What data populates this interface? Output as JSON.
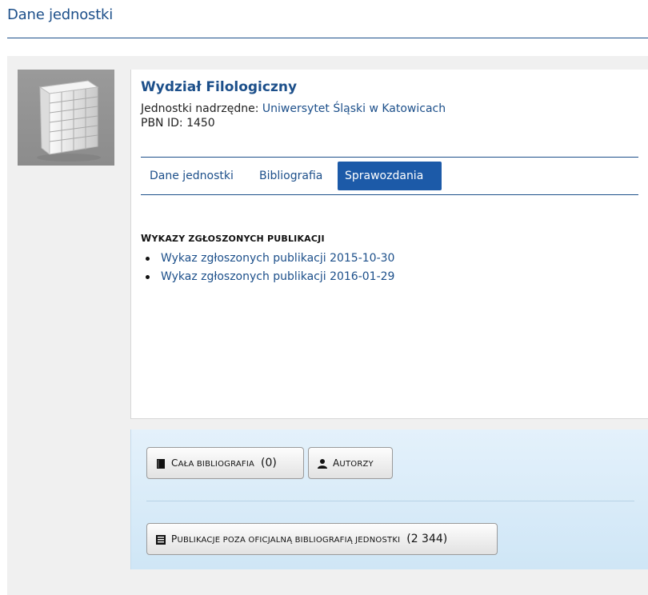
{
  "page": {
    "title": "Dane jednostki"
  },
  "unit": {
    "name": "Wydział Filologiczny",
    "parent_label": "Jednostki nadrzędne:",
    "parent_link": "Uniwersytet Śląski w Katowicach",
    "pbn_label": "PBN ID:",
    "pbn_id": "1450"
  },
  "tabs": [
    {
      "label": "Dane jednostki",
      "active": false
    },
    {
      "label": "Bibliografia",
      "active": false
    },
    {
      "label": "Sprawozdania",
      "active": true
    }
  ],
  "reports": {
    "heading_initial": "W",
    "heading_rest": "YKAZY ZGŁOSZONYCH PUBLIKACJI",
    "items": [
      "Wykaz zgłoszonych publikacji 2015-10-30",
      "Wykaz zgłoszonych publikacji 2016-01-29"
    ]
  },
  "actions": {
    "all_bib": {
      "initial": "C",
      "rest": "AŁA BIBLIOGRAFIA",
      "count": "(0)",
      "icon": "book-icon"
    },
    "authors": {
      "initial": "A",
      "rest": "UTORZY",
      "icon": "user-icon"
    },
    "outside": {
      "initial": "P",
      "rest": "UBLIKACJE POZA OFICJALNĄ BIBLIOGRAFIĄ JEDNOSTKI",
      "count": "(2 344)",
      "icon": "list-icon"
    }
  },
  "colors": {
    "accent": "#1c4f8a",
    "active_tab": "#1c5aa8",
    "actions_bg": "#d8ebf8"
  }
}
